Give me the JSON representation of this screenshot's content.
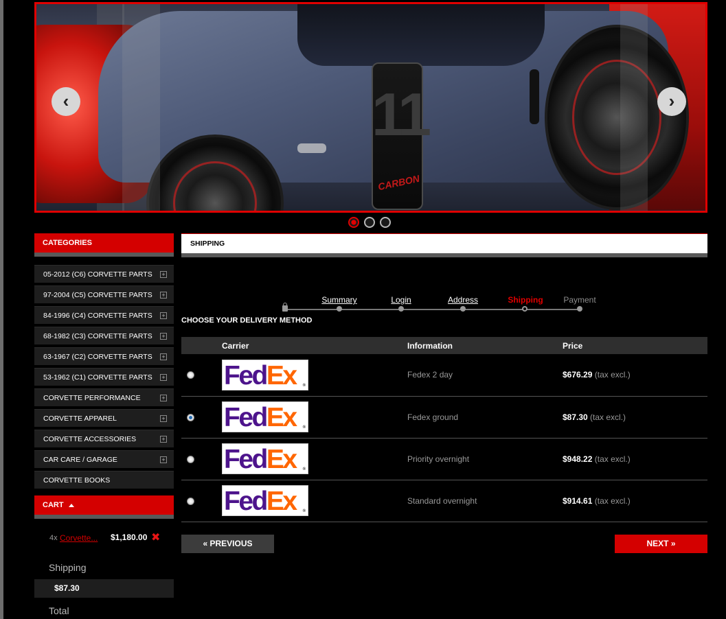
{
  "banner": {
    "race_number": "11",
    "race_word": "CARBON",
    "prev_arrow": "‹",
    "next_arrow": "›",
    "slides": 3,
    "active_slide": 1
  },
  "sidebar": {
    "categories_title": "CATEGORIES",
    "categories": [
      {
        "label": "05-2012 (C6) CORVETTE PARTS",
        "expandable": true
      },
      {
        "label": "97-2004 (C5) CORVETTE PARTS",
        "expandable": true
      },
      {
        "label": "84-1996 (C4) CORVETTE PARTS",
        "expandable": true
      },
      {
        "label": "68-1982 (C3) CORVETTE PARTS",
        "expandable": true
      },
      {
        "label": "63-1967 (C2) CORVETTE PARTS",
        "expandable": true
      },
      {
        "label": "53-1962 (C1) CORVETTE PARTS",
        "expandable": true
      },
      {
        "label": "CORVETTE PERFORMANCE",
        "expandable": true
      },
      {
        "label": "CORVETTE APPAREL",
        "expandable": true
      },
      {
        "label": "CORVETTE ACCESSORIES",
        "expandable": true
      },
      {
        "label": "CAR CARE / GARAGE",
        "expandable": true
      },
      {
        "label": "CORVETTE BOOKS",
        "expandable": false
      }
    ],
    "expand_icon": "⊞",
    "cart": {
      "title": "CART",
      "item_qty": "4x",
      "item_name": "Corvette...",
      "item_price": "$1,180.00",
      "remove_icon": "✖",
      "shipping_label": "Shipping",
      "shipping_value": "$87.30",
      "total_label": "Total"
    }
  },
  "main": {
    "title": "SHIPPING",
    "steps": [
      {
        "label": "Summary",
        "state": "done"
      },
      {
        "label": "Login",
        "state": "done"
      },
      {
        "label": "Address",
        "state": "done"
      },
      {
        "label": "Shipping",
        "state": "current"
      },
      {
        "label": "Payment",
        "state": "todo"
      }
    ],
    "section_title": "CHOOSE YOUR DELIVERY METHOD",
    "table": {
      "headers": [
        "",
        "Carrier",
        "Information",
        "Price"
      ],
      "rows": [
        {
          "carrier": "FedEx",
          "information": "Fedex 2 day",
          "price": "$676.29",
          "tax": "(tax excl.)",
          "selected": false
        },
        {
          "carrier": "FedEx",
          "information": "Fedex ground",
          "price": "$87.30",
          "tax": "(tax excl.)",
          "selected": true
        },
        {
          "carrier": "FedEx",
          "information": "Priority overnight",
          "price": "$948.22",
          "tax": "(tax excl.)",
          "selected": false
        },
        {
          "carrier": "FedEx",
          "information": "Standard overnight",
          "price": "$914.61",
          "tax": "(tax excl.)",
          "selected": false
        }
      ]
    },
    "prev_label": "« PREVIOUS",
    "next_label": "NEXT »"
  },
  "colors": {
    "accent": "#d40000",
    "background": "#000000",
    "fedex_purple": "#4d148c",
    "fedex_orange": "#ff6600"
  }
}
